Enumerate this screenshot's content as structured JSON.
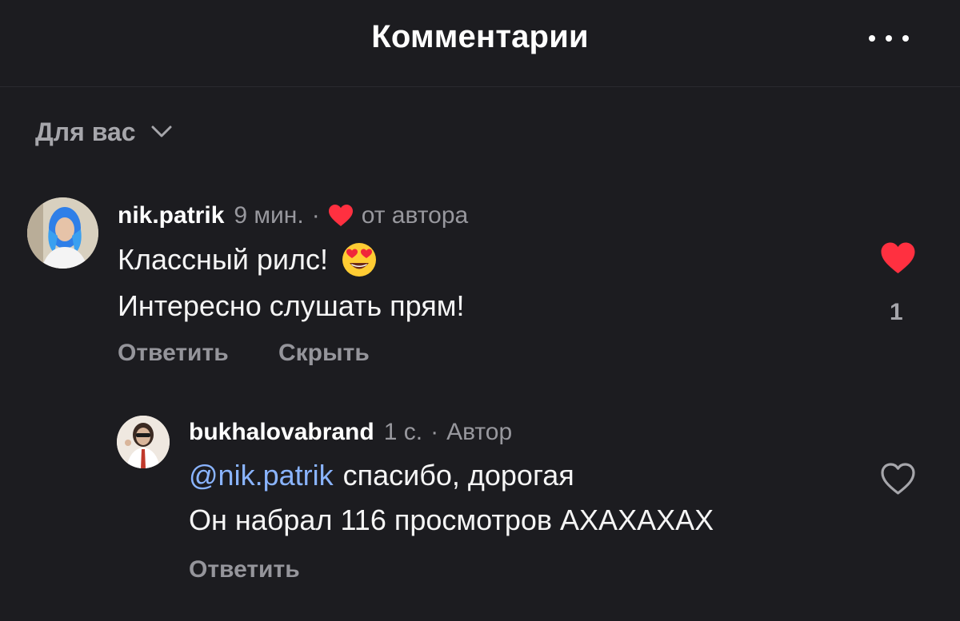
{
  "header": {
    "title": "Комментарии"
  },
  "filter": {
    "label": "Для вас"
  },
  "comments": [
    {
      "username": "nik.patrik",
      "time": "9 мин.",
      "separator": "·",
      "badge": "от автора",
      "lines": [
        "Классный рилс!",
        "Интересно слушать прям!"
      ],
      "emoji": "heart-eyes-emoji",
      "actions": {
        "reply": "Ответить",
        "hide": "Скрыть"
      },
      "like_count": "1",
      "liked": true
    },
    {
      "username": "bukhalovabrand",
      "time": "1 с.",
      "separator": "·",
      "badge": "Автор",
      "mention": "@nik.patrik",
      "lines": [
        "спасибо, дорогая",
        "Он набрал 116 просмотров АХАХАХАХ"
      ],
      "actions": {
        "reply": "Ответить"
      },
      "liked": false
    }
  ],
  "colors": {
    "background": "#1c1c20",
    "mention": "#8ab4ff",
    "like": "#ff3040",
    "muted": "#98989e"
  }
}
